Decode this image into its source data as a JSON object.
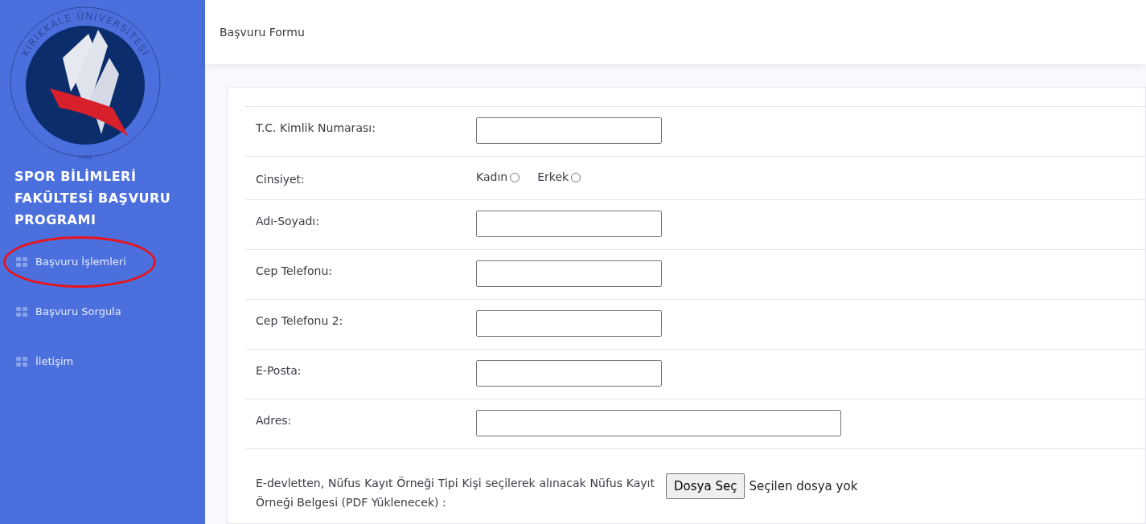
{
  "sidebar": {
    "logo": {
      "ring_text": "KIRIKKALE ÜNİVERSİTESİ",
      "year": "1992"
    },
    "brand": "SPOR BİLİMLERİ FAKÜLTESİ BAŞVURU PROGRAMI",
    "items": [
      {
        "label": "Başvuru İşlemleri",
        "highlighted": true
      },
      {
        "label": "Başvuru Sorgula",
        "highlighted": false
      },
      {
        "label": "İletişim",
        "highlighted": false
      }
    ]
  },
  "header": {
    "title": "Başvuru Formu"
  },
  "form": {
    "rows": [
      {
        "kind": "text",
        "label": "T.C. Kimlik Numarası:"
      },
      {
        "kind": "radio",
        "label": "Cinsiyet:",
        "options": [
          {
            "label": "Kadın",
            "selected": false
          },
          {
            "label": "Erkek",
            "selected": false
          }
        ]
      },
      {
        "kind": "text",
        "label": "Adı-Soyadı:"
      },
      {
        "kind": "text",
        "label": "Cep Telefonu:"
      },
      {
        "kind": "text",
        "label": "Cep Telefonu 2:"
      },
      {
        "kind": "text",
        "label": "E-Posta:"
      },
      {
        "kind": "wide",
        "label": "Adres:"
      },
      {
        "kind": "file",
        "label": "E-devletten, Nüfus Kayıt Örneği Tipi Kişi seçilerek alınacak Nüfus Kayıt Örneği Belgesi (PDF Yüklenecek) :",
        "button": "Dosya Seç",
        "status": "Seçilen dosya yok"
      }
    ]
  }
}
